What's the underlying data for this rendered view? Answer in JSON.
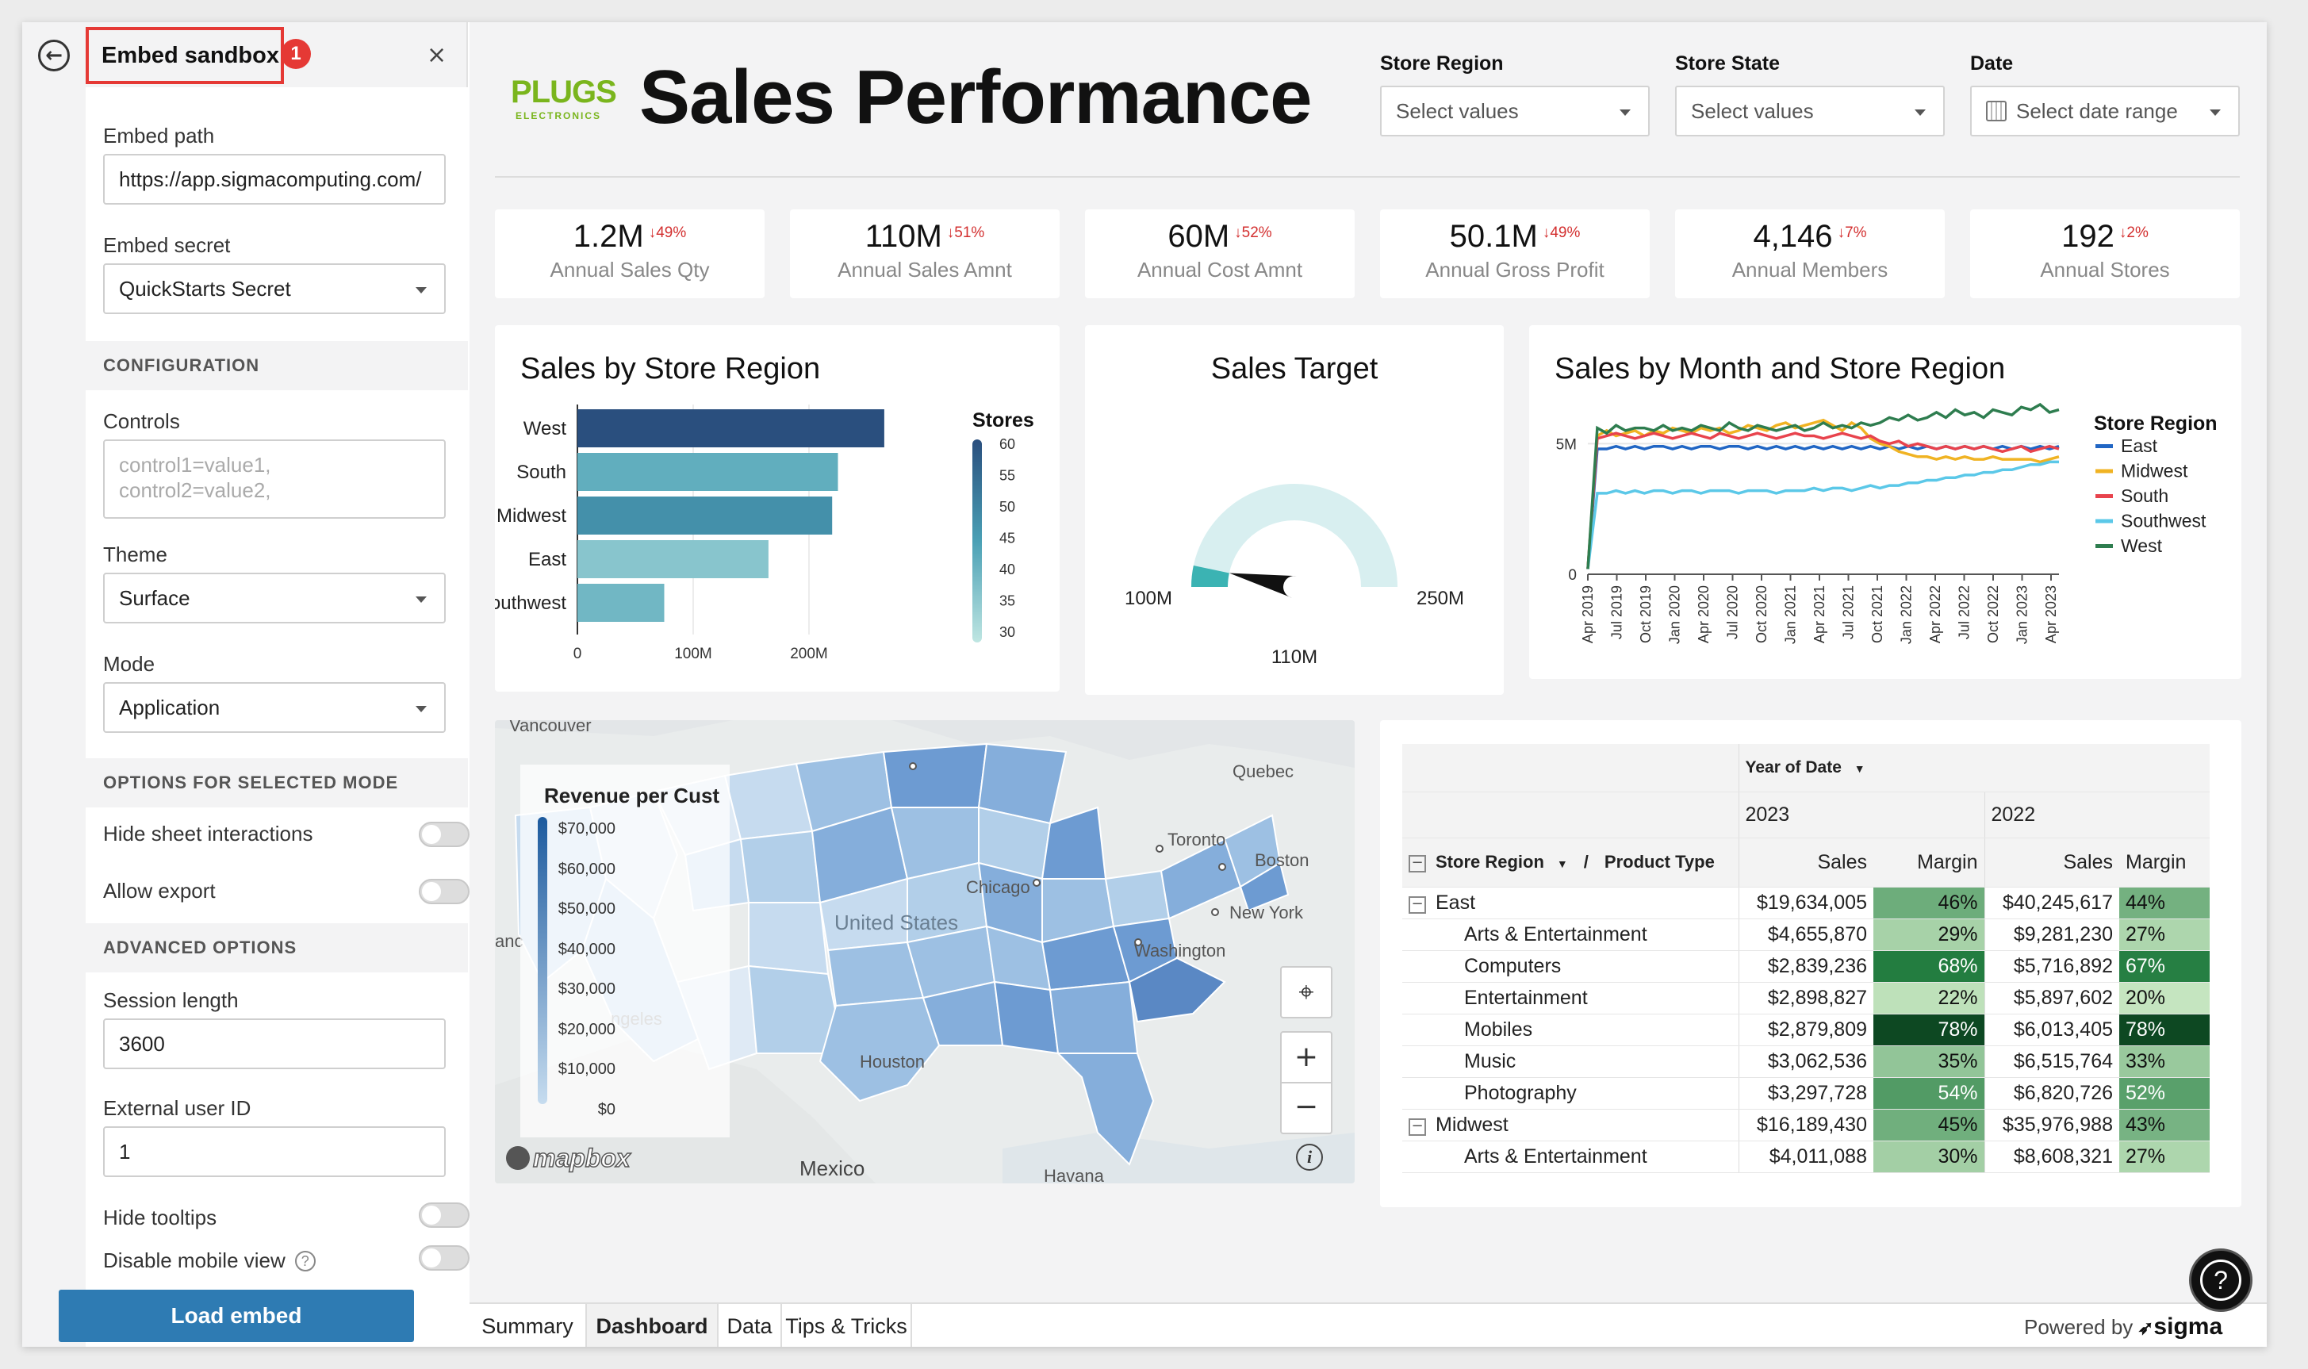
{
  "sidebar": {
    "title": "Embed sandbox",
    "badge": "1",
    "back_icon": "←",
    "close_icon": "×",
    "embed_path_label": "Embed path",
    "embed_path_value": "https://app.sigmacomputing.com/",
    "embed_secret_label": "Embed secret",
    "embed_secret_value": "QuickStarts Secret",
    "configuration_header": "CONFIGURATION",
    "controls_label": "Controls",
    "controls_placeholder": "control1=value1,\ncontrol2=value2,",
    "theme_label": "Theme",
    "theme_value": "Surface",
    "mode_label": "Mode",
    "mode_value": "Application",
    "options_header": "OPTIONS FOR SELECTED MODE",
    "hide_sheet_interactions": "Hide sheet interactions",
    "allow_export": "Allow export",
    "advanced_header": "ADVANCED OPTIONS",
    "session_length_label": "Session length",
    "session_length_value": "3600",
    "external_user_label": "External user ID",
    "external_user_value": "1",
    "hide_tooltips": "Hide tooltips",
    "disable_mobile": "Disable mobile view",
    "load_button": "Load embed"
  },
  "header": {
    "logo_line1": "PLUGS",
    "logo_line2": "ELECTRONICS",
    "title": "Sales Performance",
    "filters": [
      {
        "label": "Store Region",
        "placeholder": "Select values"
      },
      {
        "label": "Store State",
        "placeholder": "Select values"
      },
      {
        "label": "Date",
        "placeholder": "Select date range"
      }
    ]
  },
  "kpis": [
    {
      "value": "1.2M",
      "delta": "↓49%",
      "label": "Annual Sales Qty"
    },
    {
      "value": "110M",
      "delta": "↓51%",
      "label": "Annual Sales Amnt"
    },
    {
      "value": "60M",
      "delta": "↓52%",
      "label": "Annual Cost Amnt"
    },
    {
      "value": "50.1M",
      "delta": "↓49%",
      "label": "Annual Gross Profit"
    },
    {
      "value": "4,146",
      "delta": "↓7%",
      "label": "Annual Members"
    },
    {
      "value": "192",
      "delta": "↓2%",
      "label": "Annual Stores"
    }
  ],
  "chart_data": [
    {
      "type": "bar",
      "orientation": "horizontal",
      "title": "Sales by Store Region",
      "categories": [
        "West",
        "South",
        "Midwest",
        "East",
        "Southwest"
      ],
      "values": [
        265,
        225,
        220,
        165,
        75
      ],
      "color_values": [
        60,
        42,
        48,
        37,
        40
      ],
      "x_ticks": [
        "0",
        "100M",
        "200M"
      ],
      "xlim": [
        0,
        280
      ],
      "legend_title": "Stores",
      "legend_ticks": [
        "60",
        "55",
        "50",
        "45",
        "40",
        "35",
        "30"
      ],
      "colors": {
        "low": "#bfe6e2",
        "mid": "#4aa0b5",
        "high": "#2a4f7e"
      }
    },
    {
      "type": "gauge",
      "title": "Sales Target",
      "min_label": "100M",
      "max_label": "250M",
      "value_label": "110M",
      "min": 100,
      "max": 250,
      "value": 110,
      "colors": {
        "track": "#d8eff0",
        "fill": "#3bb3b3",
        "needle": "#111111"
      }
    },
    {
      "type": "line",
      "title": "Sales by Month and Store Region",
      "x_labels": [
        "Apr 2019",
        "Jul 2019",
        "Oct 2019",
        "Jan 2020",
        "Apr 2020",
        "Jul 2020",
        "Oct 2020",
        "Jan 2021",
        "Apr 2021",
        "Jul 2021",
        "Oct 2021",
        "Jan 2022",
        "Apr 2022",
        "Jul 2022",
        "Oct 2022",
        "Jan 2023",
        "Apr 2023"
      ],
      "y_ticks": [
        "0",
        "5M"
      ],
      "ylim": [
        0,
        6.5
      ],
      "legend_title": "Store Region",
      "series": [
        {
          "name": "East",
          "color": "#2166c4",
          "values": [
            0.2,
            4.8,
            4.8,
            4.9,
            4.8,
            4.9,
            4.8,
            4.9,
            4.9,
            4.8,
            4.9,
            4.8,
            4.9,
            4.9,
            4.8,
            4.9,
            4.9,
            4.8,
            4.9,
            4.8,
            4.9,
            4.8,
            4.9,
            4.8,
            4.9,
            4.8,
            4.9,
            4.8,
            4.9,
            4.8,
            4.9,
            4.8,
            4.9,
            4.8,
            4.9,
            4.8,
            4.9,
            4.8,
            4.9,
            4.8,
            4.9,
            4.8,
            4.9,
            4.8,
            4.9,
            4.8,
            4.9,
            4.8,
            4.9,
            4.8,
            4.9
          ]
        },
        {
          "name": "Midwest",
          "color": "#f0b323",
          "values": [
            0.2,
            5.3,
            5.5,
            5.3,
            5.4,
            5.5,
            5.3,
            5.5,
            5.4,
            5.6,
            5.5,
            5.4,
            5.6,
            5.5,
            5.6,
            5.4,
            5.5,
            5.7,
            5.6,
            5.5,
            5.7,
            5.8,
            5.6,
            5.7,
            5.8,
            5.9,
            5.7,
            5.5,
            5.8,
            5.6,
            5.2,
            5.0,
            4.9,
            4.7,
            4.6,
            4.5,
            4.5,
            4.4,
            4.5,
            4.4,
            4.5,
            4.4,
            4.4,
            4.5,
            4.4,
            4.4,
            4.4,
            4.4,
            4.3,
            4.4,
            4.5
          ]
        },
        {
          "name": "South",
          "color": "#e8434d",
          "values": [
            0.2,
            5.2,
            5.3,
            5.4,
            5.3,
            5.2,
            5.3,
            5.4,
            5.3,
            5.2,
            5.3,
            5.4,
            5.3,
            5.2,
            5.4,
            5.3,
            5.2,
            5.3,
            5.4,
            5.3,
            5.2,
            5.3,
            5.4,
            5.3,
            5.3,
            5.2,
            5.3,
            5.4,
            5.3,
            5.2,
            5.3,
            5.1,
            5.0,
            5.1,
            4.9,
            5.0,
            4.9,
            4.8,
            4.9,
            4.8,
            4.9,
            4.8,
            4.9,
            4.8,
            4.7,
            4.8,
            4.9,
            4.7,
            4.8,
            4.9,
            4.8
          ]
        },
        {
          "name": "Southwest",
          "color": "#5bc8e8",
          "values": [
            0.2,
            3.1,
            3.1,
            3.2,
            3.1,
            3.2,
            3.1,
            3.2,
            3.2,
            3.1,
            3.2,
            3.2,
            3.1,
            3.2,
            3.2,
            3.2,
            3.1,
            3.2,
            3.2,
            3.2,
            3.1,
            3.2,
            3.2,
            3.2,
            3.3,
            3.2,
            3.3,
            3.3,
            3.2,
            3.3,
            3.4,
            3.3,
            3.4,
            3.4,
            3.5,
            3.5,
            3.6,
            3.6,
            3.7,
            3.7,
            3.8,
            3.8,
            3.9,
            3.9,
            4.0,
            4.0,
            4.1,
            4.2,
            4.2,
            4.3,
            4.3
          ]
        },
        {
          "name": "West",
          "color": "#2e7d4f",
          "values": [
            0.2,
            5.6,
            5.4,
            5.7,
            5.5,
            5.6,
            5.6,
            5.5,
            5.7,
            5.5,
            5.6,
            5.5,
            5.7,
            5.6,
            5.5,
            5.8,
            5.6,
            5.5,
            5.7,
            5.6,
            5.5,
            5.6,
            5.7,
            5.5,
            5.6,
            5.8,
            5.6,
            5.7,
            5.6,
            5.8,
            5.7,
            5.8,
            6.0,
            5.9,
            6.1,
            5.9,
            6.0,
            6.2,
            6.0,
            6.3,
            6.1,
            6.2,
            6.0,
            6.3,
            6.2,
            6.1,
            6.4,
            6.3,
            6.5,
            6.2,
            6.3
          ]
        }
      ]
    }
  ],
  "map": {
    "legend_title": "Revenue per Cust",
    "legend_ticks": [
      "$70,000",
      "$60,000",
      "$50,000",
      "$40,000",
      "$30,000",
      "$20,000",
      "$10,000",
      "$0"
    ],
    "labels": {
      "vancouver": "Vancouver",
      "quebec": "Quebec",
      "toronto": "Toronto",
      "boston": "Boston",
      "chicago": "Chicago",
      "new_york": "New York",
      "washington": "Washington",
      "houston": "Houston",
      "united_states": "United States",
      "mexico": "Mexico",
      "havana": "Havana",
      "sf_partial": "anc",
      "la_partial": "ngeles"
    },
    "attribution": "mapbox",
    "zoom_in": "+",
    "zoom_out": "−",
    "info": "i"
  },
  "pivot": {
    "col_header": "Year of Date",
    "years": [
      "2023",
      "2022"
    ],
    "row_header_1": "Store Region",
    "row_header_sep": "/",
    "row_header_2": "Product Type",
    "measures": [
      "Sales",
      "Margin",
      "Sales",
      "Margin"
    ],
    "rows": [
      {
        "label": "East",
        "group": true,
        "s23": "$19,634,005",
        "m23": "46%",
        "s22": "$40,245,617",
        "m22": "44%",
        "p23": 46,
        "p22": 44
      },
      {
        "label": "Arts & Entertainment",
        "group": false,
        "s23": "$4,655,870",
        "m23": "29%",
        "s22": "$9,281,230",
        "m22": "27%",
        "p23": 29,
        "p22": 27
      },
      {
        "label": "Computers",
        "group": false,
        "s23": "$2,839,236",
        "m23": "68%",
        "s22": "$5,716,892",
        "m22": "67%",
        "p23": 68,
        "p22": 67
      },
      {
        "label": "Entertainment",
        "group": false,
        "s23": "$2,898,827",
        "m23": "22%",
        "s22": "$5,897,602",
        "m22": "20%",
        "p23": 22,
        "p22": 20
      },
      {
        "label": "Mobiles",
        "group": false,
        "s23": "$2,879,809",
        "m23": "78%",
        "s22": "$6,013,405",
        "m22": "78%",
        "p23": 78,
        "p22": 78
      },
      {
        "label": "Music",
        "group": false,
        "s23": "$3,062,536",
        "m23": "35%",
        "s22": "$6,515,764",
        "m22": "33%",
        "p23": 35,
        "p22": 33
      },
      {
        "label": "Photography",
        "group": false,
        "s23": "$3,297,728",
        "m23": "54%",
        "s22": "$6,820,726",
        "m22": "52%",
        "p23": 54,
        "p22": 52
      },
      {
        "label": "Midwest",
        "group": true,
        "s23": "$16,189,430",
        "m23": "45%",
        "s22": "$35,976,988",
        "m22": "43%",
        "p23": 45,
        "p22": 43
      },
      {
        "label": "Arts & Entertainment",
        "group": false,
        "s23": "$4,011,088",
        "m23": "30%",
        "s22": "$8,608,321",
        "m22": "27%",
        "p23": 30,
        "p22": 27
      }
    ]
  },
  "tabs": [
    "Summary",
    "Dashboard",
    "Data",
    "Tips & Tricks"
  ],
  "active_tab": "Dashboard",
  "footer": {
    "powered_by": "Powered by",
    "brand": "sigma"
  },
  "help_label": "?"
}
